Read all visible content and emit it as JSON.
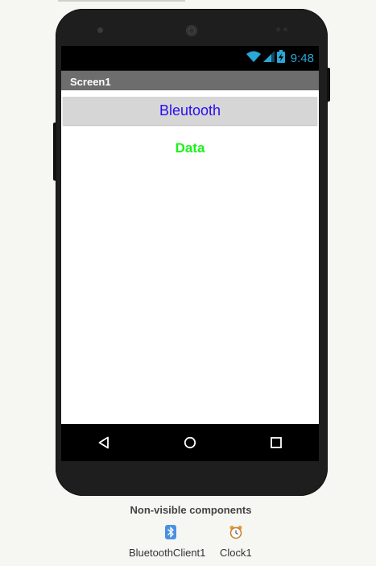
{
  "status_bar": {
    "time": "9:48",
    "icons": [
      "wifi-icon",
      "signal-icon",
      "battery-icon"
    ],
    "accent_color": "#2aa6d8"
  },
  "screen": {
    "title": "Screen1",
    "bluetooth_button_label": "Bleutooth",
    "bluetooth_button_color": "#2a0cf0",
    "data_label": "Data",
    "data_label_color": "#19f219"
  },
  "nav_bar": {
    "icons": [
      "back-icon",
      "home-icon",
      "recents-icon"
    ]
  },
  "non_visible": {
    "title": "Non-visible components",
    "components": [
      {
        "name": "BluetoothClient1",
        "icon": "bluetooth-icon"
      },
      {
        "name": "Clock1",
        "icon": "clock-icon"
      }
    ]
  }
}
